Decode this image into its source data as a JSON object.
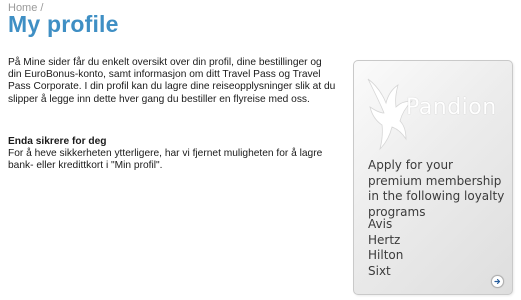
{
  "breadcrumb": {
    "home": "Home",
    "separator": "/"
  },
  "page": {
    "title": "My profile"
  },
  "content": {
    "intro": "På Mine sider får du enkelt oversikt over din profil, dine bestillinger og din EuroBonus-konto, samt informasjon om ditt Travel Pass og Travel Pass Corporate. I din profil kan du lagre dine reiseopplysninger slik at du slipper å legge inn dette hver gang du bestiller en flyreise med oss.",
    "security_heading": "Enda sikrere for deg",
    "security_text": "For å heve sikkerheten ytterligere, har vi fjernet muligheten for å lagre bank- eller kredittkort i \"Min profil\"."
  },
  "promo": {
    "brand": "Pandion",
    "heading": "Apply for your premium membership in the following loyalty programs",
    "programs": [
      "Avis",
      "Hertz",
      "Hilton",
      "Sixt"
    ],
    "arrow_icon": "arrow-right-icon",
    "accent_color": "#3f8fc4"
  }
}
